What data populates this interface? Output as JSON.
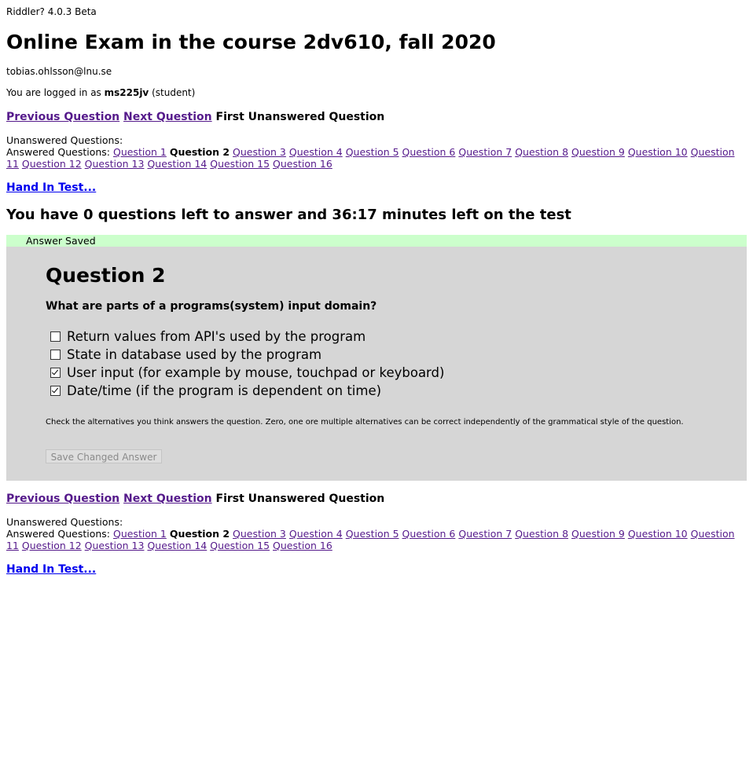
{
  "app_version": "Riddler? 4.0.3 Beta",
  "page_title": "Online Exam in the course 2dv610, fall 2020",
  "email": "tobias.ohlsson@lnu.se",
  "login": {
    "prefix": "You are logged in as ",
    "username": "ms225jv",
    "role": " (student)"
  },
  "nav": {
    "previous": "Previous Question",
    "next": "Next Question",
    "first_unanswered": "First Unanswered Question"
  },
  "lists": {
    "unanswered_label": "Unanswered Questions:",
    "answered_label": "Answered Questions:",
    "answered_before": [
      "Question 1"
    ],
    "current": "Question 2",
    "answered_after": [
      "Question 3",
      "Question 4",
      "Question 5",
      "Question 6",
      "Question 7",
      "Question 8",
      "Question 9",
      "Question 10",
      "Question 11",
      "Question 12",
      "Question 13",
      "Question 14",
      "Question 15",
      "Question 16"
    ]
  },
  "hand_in": "Hand In Test...",
  "status": "You have 0 questions left to answer and 36:17 minutes left on the test",
  "saved_message": "Answer Saved",
  "question": {
    "title": "Question 2",
    "text": "What are parts of a programs(system) input domain?",
    "options": [
      {
        "label": "Return values from API's used by the program",
        "checked": false
      },
      {
        "label": "State in database used by the program",
        "checked": false
      },
      {
        "label": "User input (for example by mouse, touchpad or keyboard)",
        "checked": true
      },
      {
        "label": "Date/time (if the program is dependent on time)",
        "checked": true
      }
    ],
    "help": "Check the alternatives you think answers the question. Zero, one ore multiple alternatives can be correct independently of the grammatical style of the question.",
    "save_button": "Save Changed Answer"
  },
  "colors": {
    "saved_bar": "#ccffcc",
    "question_bg": "#d6d6d6",
    "visited_link": "#551a8b",
    "link": "#0000ee"
  }
}
